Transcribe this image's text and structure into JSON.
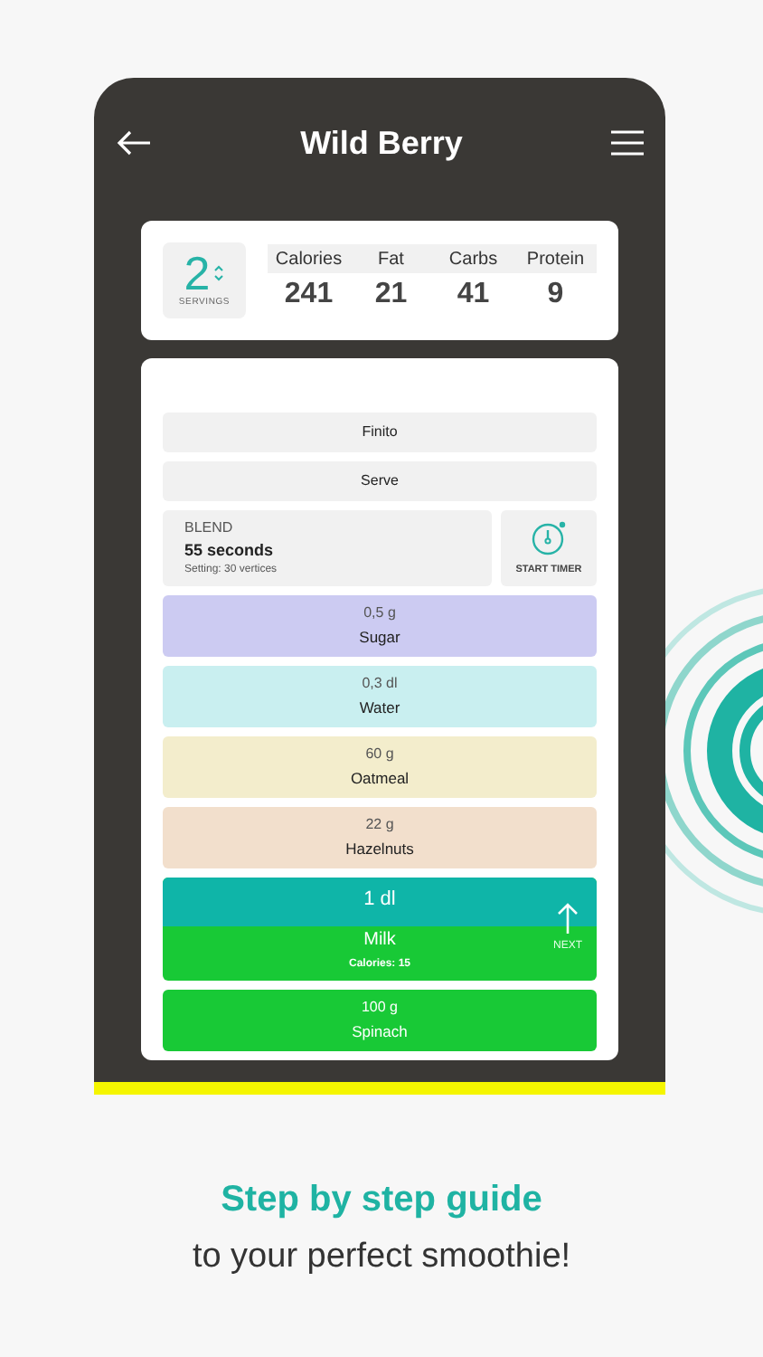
{
  "header": {
    "title": "Wild Berry"
  },
  "servings": {
    "value": "2",
    "label": "SERVINGS"
  },
  "nutrition": [
    {
      "label": "Calories",
      "value": "241"
    },
    {
      "label": "Fat",
      "value": "21"
    },
    {
      "label": "Carbs",
      "value": "41"
    },
    {
      "label": "Protein",
      "value": "9"
    }
  ],
  "steps": [
    {
      "kind": "action",
      "label": "Finito"
    },
    {
      "kind": "action",
      "label": "Serve"
    },
    {
      "kind": "blend",
      "title": "BLEND",
      "duration": "55 seconds",
      "setting": "Setting: 30 vertices",
      "timer_label": "START TIMER"
    },
    {
      "kind": "ingredient",
      "amount": "0,5 g",
      "name": "Sugar",
      "color": "#cccbf2",
      "current": false
    },
    {
      "kind": "ingredient",
      "amount": "0,3 dl",
      "name": "Water",
      "color": "#c9eff0",
      "current": false
    },
    {
      "kind": "ingredient",
      "amount": "60 g",
      "name": "Oatmeal",
      "color": "#f3edcc",
      "current": false
    },
    {
      "kind": "ingredient",
      "amount": "22 g",
      "name": "Hazelnuts",
      "color": "#f2dfcc",
      "current": false
    },
    {
      "kind": "ingredient",
      "amount": "1 dl",
      "name": "Milk",
      "color": "#18c936",
      "current": true,
      "calories": "Calories: 15",
      "next_label": "NEXT"
    },
    {
      "kind": "ingredient",
      "amount": "100 g",
      "name": "Spinach",
      "color": "#18c936",
      "current": false
    }
  ],
  "caption": {
    "headline": "Step by step guide",
    "subline": "to your perfect smoothie!"
  }
}
